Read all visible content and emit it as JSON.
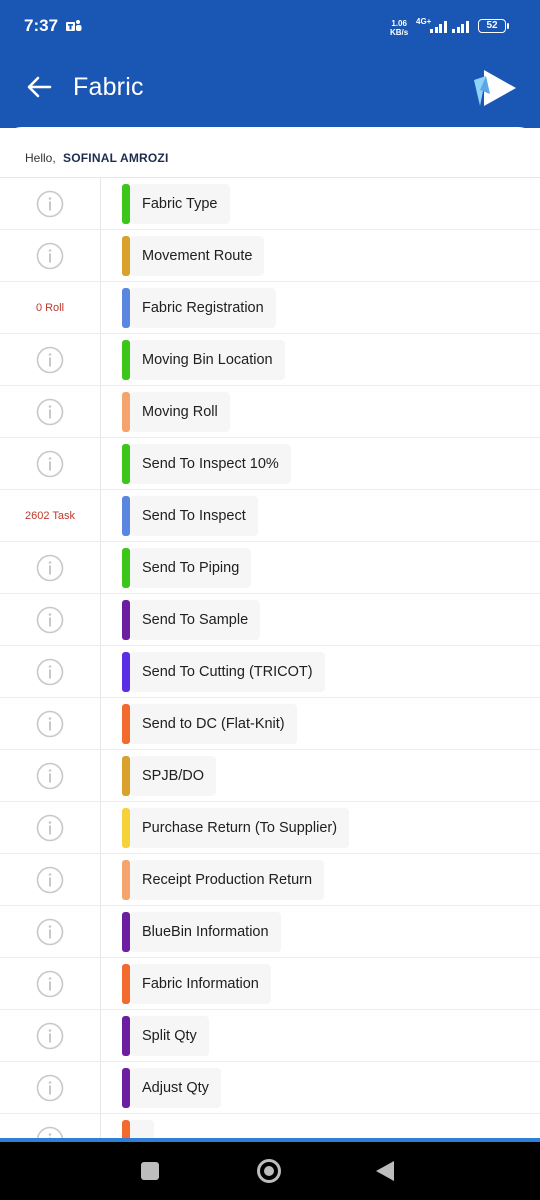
{
  "status_bar": {
    "time": "7:37",
    "net_speed_value": "1.06",
    "net_speed_unit": "KB/s",
    "net_type": "4G+",
    "net_type_small": "4G",
    "battery": "52"
  },
  "header": {
    "title": "Fabric"
  },
  "greeting": {
    "prefix": "Hello,",
    "user": "SOFINAL AMROZI"
  },
  "menu": [
    {
      "label": "Fabric Type",
      "color": "#3cc61a",
      "badge": ""
    },
    {
      "label": "Movement Route",
      "color": "#d9a22e",
      "badge": ""
    },
    {
      "label": "Fabric Registration",
      "color": "#5b86e0",
      "badge": "0 Roll"
    },
    {
      "label": "Moving Bin Location",
      "color": "#3cc61a",
      "badge": ""
    },
    {
      "label": "Moving Roll",
      "color": "#f4a46c",
      "badge": ""
    },
    {
      "label": "Send To Inspect 10%",
      "color": "#3cc61a",
      "badge": ""
    },
    {
      "label": "Send To Inspect",
      "color": "#5b86e0",
      "badge": "2602 Task"
    },
    {
      "label": "Send To Piping",
      "color": "#3cc61a",
      "badge": ""
    },
    {
      "label": "Send To Sample",
      "color": "#6b1fa0",
      "badge": ""
    },
    {
      "label": "Send To Cutting (TRICOT)",
      "color": "#5b2ee6",
      "badge": ""
    },
    {
      "label": "Send to DC (Flat-Knit)",
      "color": "#f36a2e",
      "badge": ""
    },
    {
      "label": "SPJB/DO",
      "color": "#d9a22e",
      "badge": ""
    },
    {
      "label": "Purchase Return (To Supplier)",
      "color": "#f5d23a",
      "badge": ""
    },
    {
      "label": "Receipt Production Return",
      "color": "#f4a46c",
      "badge": ""
    },
    {
      "label": "BlueBin Information",
      "color": "#6b1fa0",
      "badge": ""
    },
    {
      "label": "Fabric Information",
      "color": "#f36a2e",
      "badge": ""
    },
    {
      "label": "Split Qty",
      "color": "#6b1fa0",
      "badge": ""
    },
    {
      "label": "Adjust Qty",
      "color": "#6b1fa0",
      "badge": ""
    },
    {
      "label": "",
      "color": "#f36a2e",
      "badge": ""
    }
  ],
  "icons": {
    "back": "arrow-left-icon",
    "logo": "app-logo",
    "info": "info-icon",
    "teams": "teams-icon"
  }
}
